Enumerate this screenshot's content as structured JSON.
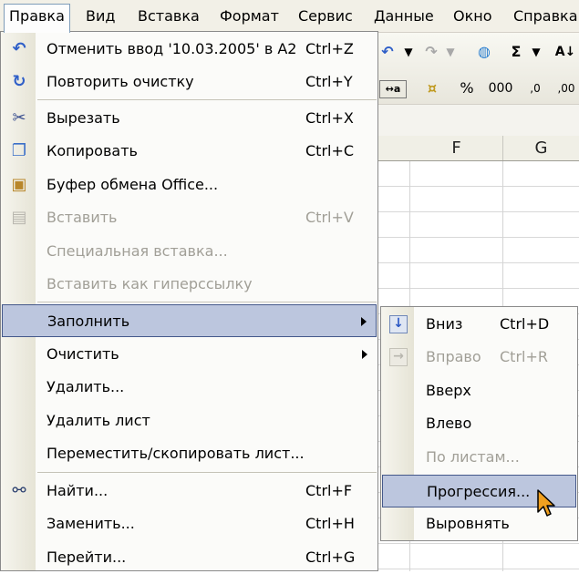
{
  "menubar": {
    "items": [
      "Правка",
      "Вид",
      "Вставка",
      "Формат",
      "Сервис",
      "Данные",
      "Окно",
      "Справка"
    ]
  },
  "toolbar": {
    "sigma": "Σ",
    "percent": "%",
    "thousands": "000",
    "inc_dec": ",0",
    "dec_dec": ",00"
  },
  "columns": [
    "F",
    "G"
  ],
  "menu": {
    "items": [
      {
        "label": "Отменить ввод '10.03.2005' в A2",
        "shortcut": "Ctrl+Z",
        "icon": "undo-icon"
      },
      {
        "label": "Повторить очистку",
        "shortcut": "Ctrl+Y",
        "icon": "redo-icon"
      },
      {
        "label": "Вырезать",
        "shortcut": "Ctrl+X",
        "icon": "scissors-icon"
      },
      {
        "label": "Копировать",
        "shortcut": "Ctrl+C",
        "icon": "copy-icon"
      },
      {
        "label": "Буфер обмена Office...",
        "shortcut": "",
        "icon": "clipboard-icon"
      },
      {
        "label": "Вставить",
        "shortcut": "Ctrl+V",
        "icon": "paste-icon"
      },
      {
        "label": "Специальная вставка...",
        "shortcut": ""
      },
      {
        "label": "Вставить как гиперссылку",
        "shortcut": ""
      },
      {
        "label": "Заполнить",
        "shortcut": ""
      },
      {
        "label": "Очистить",
        "shortcut": ""
      },
      {
        "label": "Удалить...",
        "shortcut": ""
      },
      {
        "label": "Удалить лист",
        "shortcut": ""
      },
      {
        "label": "Переместить/скопировать лист...",
        "shortcut": ""
      },
      {
        "label": "Найти...",
        "shortcut": "Ctrl+F",
        "icon": "binoculars-icon"
      },
      {
        "label": "Заменить...",
        "shortcut": "Ctrl+H"
      },
      {
        "label": "Перейти...",
        "shortcut": "Ctrl+G"
      }
    ]
  },
  "submenu": {
    "items": [
      {
        "label": "Вниз",
        "shortcut": "Ctrl+D",
        "icon": "fill-down-icon"
      },
      {
        "label": "Вправо",
        "shortcut": "Ctrl+R",
        "icon": "fill-right-icon"
      },
      {
        "label": "Вверх",
        "shortcut": ""
      },
      {
        "label": "Влево",
        "shortcut": ""
      },
      {
        "label": "По листам...",
        "shortcut": ""
      },
      {
        "label": "Прогрессия...",
        "shortcut": ""
      },
      {
        "label": "Выровнять",
        "shortcut": ""
      }
    ]
  },
  "colors": {
    "highlight_bg": "#bcc6de",
    "highlight_border": "#44588a",
    "disabled_text": "#a19f97"
  }
}
